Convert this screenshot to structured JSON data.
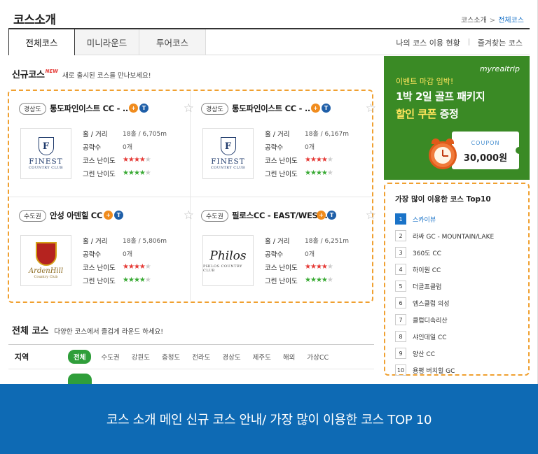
{
  "header": {
    "title": "코스소개",
    "breadcrumb": {
      "parent": "코스소개",
      "separator": ">",
      "current": "전체코스"
    }
  },
  "tabs": [
    {
      "label": "전체코스",
      "active": true
    },
    {
      "label": "미니라운드",
      "active": false
    },
    {
      "label": "투어코스",
      "active": false
    }
  ],
  "right_links": {
    "my_usage": "나의 코스 이용 현황",
    "favorites": "즐겨찾는 코스"
  },
  "new_courses": {
    "heading": "신규코스",
    "badge": "NEW",
    "subtitle": "새로 출시된 코스를 만나보세요!",
    "labels": {
      "holes": "홀 / 거리",
      "strategies": "공략수",
      "course_difficulty": "코스 난이도",
      "green_difficulty": "그린 난이도"
    },
    "cards": [
      {
        "region": "경상도",
        "name": "통도파인이스트 CC - ..",
        "holes": "18홀 / 6,705m",
        "strategies": "0개",
        "course_difficulty": 4,
        "green_difficulty": 4,
        "logo": {
          "word": "FINEST",
          "sub": "COUNTRY CLUB",
          "mark": "F"
        }
      },
      {
        "region": "경상도",
        "name": "통도파인이스트 CC - ..",
        "holes": "18홀 / 6,167m",
        "strategies": "0개",
        "course_difficulty": 4,
        "green_difficulty": 4,
        "logo": {
          "word": "FINEST",
          "sub": "COUNTRY CLUB",
          "mark": "F"
        }
      },
      {
        "region": "수도권",
        "name": "안성 아덴힐 CC",
        "holes": "18홀 / 5,806m",
        "strategies": "0개",
        "course_difficulty": 4,
        "green_difficulty": 4,
        "logo": {
          "word": "ArdenHill",
          "sub": "Country Club"
        }
      },
      {
        "region": "수도권",
        "name": "필로스CC - EAST/WEST..",
        "holes": "18홀 / 6,251m",
        "strategies": "0개",
        "course_difficulty": 4,
        "green_difficulty": 4,
        "logo": {
          "word": "Philos",
          "sub": "PHILOS COUNTRY CLUB"
        }
      }
    ],
    "icons": {
      "plus": "+",
      "t": "T"
    }
  },
  "all_courses": {
    "heading": "전체 코스",
    "subtitle": "다양한 코스에서 즐겁게 라운드 하세요!",
    "region_label": "지역",
    "filters": [
      "전체",
      "수도권",
      "강원도",
      "충청도",
      "전라도",
      "경상도",
      "제주도",
      "해외",
      "가상CC"
    ],
    "active_filter": "전체"
  },
  "ad": {
    "brand": "myrealtrip",
    "line1": "이벤트 마감 임박!",
    "line2": "1박 2일 골프 패키지",
    "line3_highlight": "할인 쿠폰",
    "line3_rest": " 증정",
    "coupon_label": "COUPON",
    "coupon_value": "30,000원",
    "colors": {
      "background": "#3a8a25",
      "highlight": "#ffe55c"
    }
  },
  "top10": {
    "title": "가장 많이 이용한 코스 Top10",
    "items": [
      {
        "rank": "1",
        "name": "스카이뷰"
      },
      {
        "rank": "2",
        "name": "라싸 GC - MOUNTAIN/LAKE"
      },
      {
        "rank": "3",
        "name": "360도 CC"
      },
      {
        "rank": "4",
        "name": "하이원 CC"
      },
      {
        "rank": "5",
        "name": "더골프클럽"
      },
      {
        "rank": "6",
        "name": "엠스클럽 의성"
      },
      {
        "rank": "7",
        "name": "클럽디속리산"
      },
      {
        "rank": "8",
        "name": "샤인데일 CC"
      },
      {
        "rank": "9",
        "name": "양산 CC"
      },
      {
        "rank": "10",
        "name": "용평 버치힐 GC"
      }
    ]
  },
  "caption": "코스 소개 메인 신규 코스 안내/ 가장 많이 이용한 코스 TOP 10",
  "colors": {
    "accent_blue": "#1a73c8",
    "highlight_orange": "#f0a030",
    "filter_green": "#2f9e3a",
    "caption_bg": "#0e6ab4"
  }
}
